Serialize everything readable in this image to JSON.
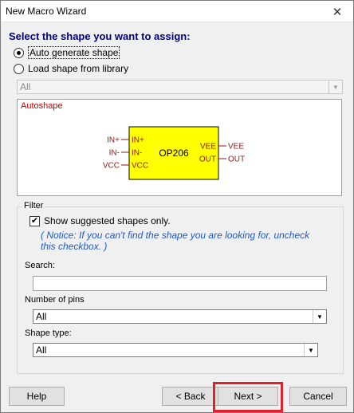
{
  "window": {
    "title": "New Macro Wizard",
    "close_symbol": "✕"
  },
  "heading": "Select the shape you want to assign:",
  "shape_source": {
    "options": [
      {
        "label": "Auto generate shape",
        "selected": true
      },
      {
        "label": "Load shape from library",
        "selected": false
      }
    ],
    "library_combo": {
      "value": "All",
      "enabled": false
    }
  },
  "preview": {
    "label": "Autoshape",
    "component": {
      "name": "OP206",
      "fill": "#ffff00",
      "left_pins": [
        {
          "outer": "IN+",
          "inner": "IN+"
        },
        {
          "outer": "IN-",
          "inner": "IN-"
        },
        {
          "outer": "VCC",
          "inner": "VCC"
        }
      ],
      "right_pins": [
        {
          "outer": "VEE",
          "inner": "VEE"
        },
        {
          "outer": "OUT",
          "inner": "OUT"
        }
      ]
    }
  },
  "filter": {
    "legend": "Filter",
    "show_suggested": {
      "label": "Show suggested shapes only.",
      "checked": true
    },
    "note": "( Notice: If you can't find the shape you are looking for, uncheck this checkbox. )",
    "search": {
      "label": "Search:",
      "value": ""
    },
    "pins": {
      "label": "Number of pins",
      "value": "All"
    },
    "shape_type": {
      "label": "Shape type:",
      "value": "All"
    }
  },
  "buttons": {
    "help": "Help",
    "back": "< Back",
    "next": "Next >",
    "cancel": "Cancel"
  },
  "colors": {
    "heading": "#000080",
    "preview_label": "#c00000",
    "pin_text": "#8b1a1a",
    "note": "#1e5ac8",
    "highlight": "#e0202a"
  }
}
